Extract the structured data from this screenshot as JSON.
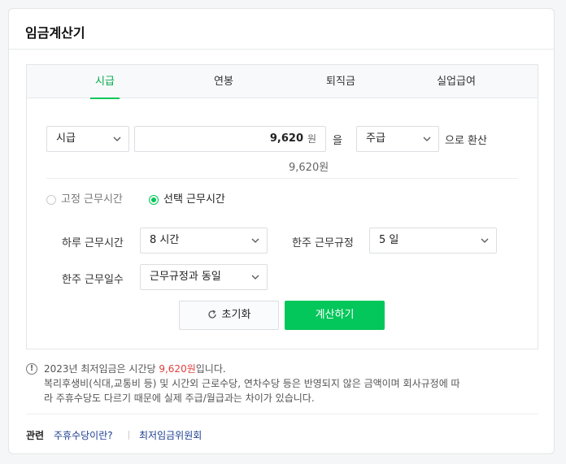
{
  "title": "임금계산기",
  "tabs": [
    {
      "label": "시급",
      "active": true
    },
    {
      "label": "연봉",
      "active": false
    },
    {
      "label": "퇴직금",
      "active": false
    },
    {
      "label": "실업급여",
      "active": false
    }
  ],
  "convert_row": {
    "from_unit": "시급",
    "amount": "9,620",
    "currency": "원",
    "particle": "을",
    "to_unit": "주급",
    "suffix": "으로 환산",
    "amount_text": "9,620원"
  },
  "work_time_mode": {
    "fixed_label": "고정 근무시간",
    "selected_label": "선택 근무시간",
    "selected": "selected"
  },
  "fields": {
    "daily_hours_label": "하루 근무시간",
    "daily_hours_value": "8 시간",
    "weekly_rule_label": "한주 근무규정",
    "weekly_rule_value": "5 일",
    "weekly_days_label": "한주 근무일수",
    "weekly_days_value": "근무규정과 동일"
  },
  "buttons": {
    "reset": "초기화",
    "calculate": "계산하기"
  },
  "notice": {
    "line1_prefix": "2023년 최저임금은 시간당 ",
    "line1_highlight": "9,620원",
    "line1_suffix": "입니다.",
    "line2": "복리후생비(식대,교통비 등) 및 시간외 근로수당, 연차수당 등은 반영되지 않은 금액이며 회사규정에 따",
    "line3": "라 주휴수당도 다르기 때문에 실제 주급/월급과는 차이가 있습니다."
  },
  "related": {
    "label": "관련",
    "links": [
      "주휴수당이란?",
      "최저임금위원회"
    ]
  },
  "colors": {
    "accent": "#03c75a",
    "highlight": "#e03f3f",
    "link": "#1a3d8f"
  }
}
